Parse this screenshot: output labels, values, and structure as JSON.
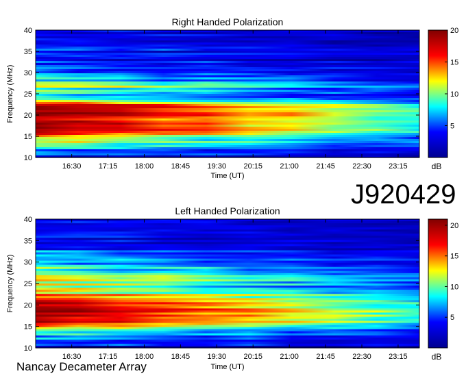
{
  "figure": {
    "observation_id": "J920429",
    "instrument": "Nancay Decameter Array"
  },
  "chart_data": [
    {
      "type": "heatmap",
      "title": "Right Handed Polarization",
      "xlabel": "Time (UT)",
      "ylabel": "Frequency (MHz)",
      "x_ticks": [
        "16:30",
        "17:15",
        "18:00",
        "18:45",
        "19:30",
        "20:15",
        "21:00",
        "21:45",
        "22:30",
        "23:15"
      ],
      "y_ticks": [
        10,
        15,
        20,
        25,
        30,
        35,
        40
      ],
      "ylim": [
        10,
        40
      ],
      "colorbar": {
        "label": "dB",
        "ticks": [
          5,
          10,
          15,
          20
        ],
        "range": [
          0,
          20
        ]
      },
      "colormap": [
        "#00008f",
        "#0000ff",
        "#00ffff",
        "#ffff00",
        "#ff0000",
        "#800000"
      ],
      "intensity_profile": [
        {
          "freq": 10,
          "db": 3
        },
        {
          "freq": 12,
          "db": 6
        },
        {
          "freq": 14,
          "db": 11
        },
        {
          "freq": 16,
          "db": 17
        },
        {
          "freq": 18,
          "db": 19
        },
        {
          "freq": 20,
          "db": 19
        },
        {
          "freq": 22,
          "db": 18
        },
        {
          "freq": 23.5,
          "db": 13
        },
        {
          "freq": 25,
          "db": 8
        },
        {
          "freq": 27,
          "db": 11
        },
        {
          "freq": 29,
          "db": 6
        },
        {
          "freq": 32,
          "db": 5
        },
        {
          "freq": 36,
          "db": 4
        },
        {
          "freq": 40,
          "db": 3
        }
      ]
    },
    {
      "type": "heatmap",
      "title": "Left Handed Polarization",
      "xlabel": "Time (UT)",
      "ylabel": "Frequency (MHz)",
      "x_ticks": [
        "16:30",
        "17:15",
        "18:00",
        "18:45",
        "19:30",
        "20:15",
        "21:00",
        "21:45",
        "22:30",
        "23:15"
      ],
      "y_ticks": [
        10,
        15,
        20,
        25,
        30,
        35,
        40
      ],
      "ylim": [
        10,
        40
      ],
      "colorbar": {
        "label": "dB",
        "ticks": [
          5,
          10,
          15,
          20
        ],
        "range": [
          0,
          21
        ]
      },
      "colormap": [
        "#00008f",
        "#0000ff",
        "#00ffff",
        "#ffff00",
        "#ff0000",
        "#800000"
      ],
      "intensity_profile": [
        {
          "freq": 10,
          "db": 3
        },
        {
          "freq": 12,
          "db": 6
        },
        {
          "freq": 14,
          "db": 10
        },
        {
          "freq": 16,
          "db": 18
        },
        {
          "freq": 18,
          "db": 20
        },
        {
          "freq": 20,
          "db": 20
        },
        {
          "freq": 22,
          "db": 16
        },
        {
          "freq": 24,
          "db": 11
        },
        {
          "freq": 26,
          "db": 13
        },
        {
          "freq": 28,
          "db": 9
        },
        {
          "freq": 30,
          "db": 7
        },
        {
          "freq": 33,
          "db": 5
        },
        {
          "freq": 36,
          "db": 4
        },
        {
          "freq": 40,
          "db": 3
        }
      ]
    }
  ]
}
